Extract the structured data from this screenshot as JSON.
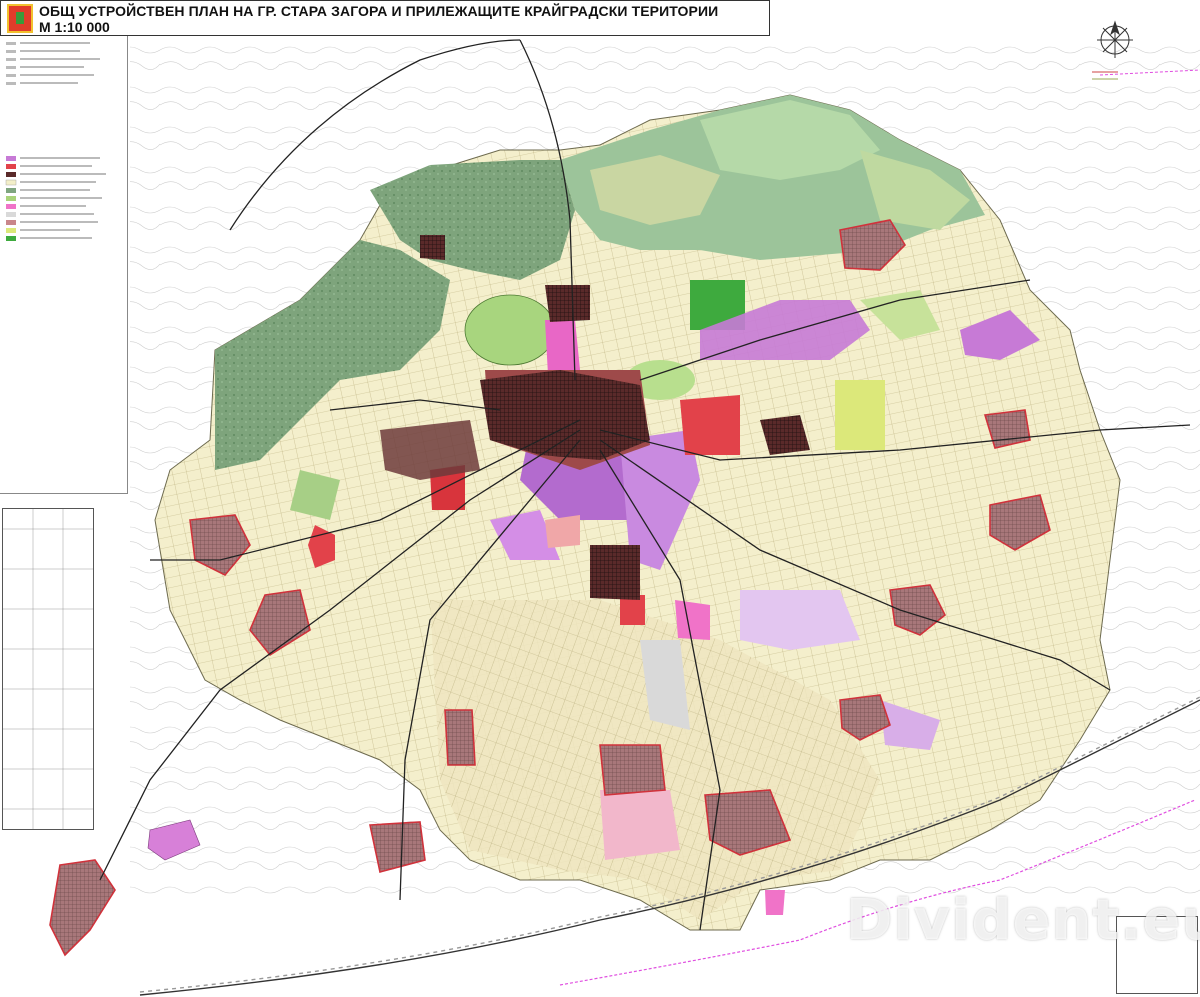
{
  "header": {
    "title": "ОБЩ УСТРОЙСТВЕН ПЛАН НА ГР. СТАРА ЗАГОРА И ПРИЛЕЖАЩИТЕ КРАЙГРАДСКИ ТЕРИТОРИИ",
    "scale": "М 1:10 000"
  },
  "watermark": "Divident.eu",
  "icons": {
    "crest": "city-coat-of-arms-icon",
    "north_arrow": "compass-rose-icon"
  },
  "colors": {
    "urban_core": "#3a1f1f",
    "residential": "#e8c8b0",
    "industrial": "#c77ad6",
    "agricultural": "#f3efc9",
    "forest": "#7fa57f",
    "park": "#a9d37a",
    "public": "#e2424a",
    "villages": "#c9868a",
    "roads": "#222222",
    "railway": "#555555",
    "boundary": "#e04fe0"
  }
}
